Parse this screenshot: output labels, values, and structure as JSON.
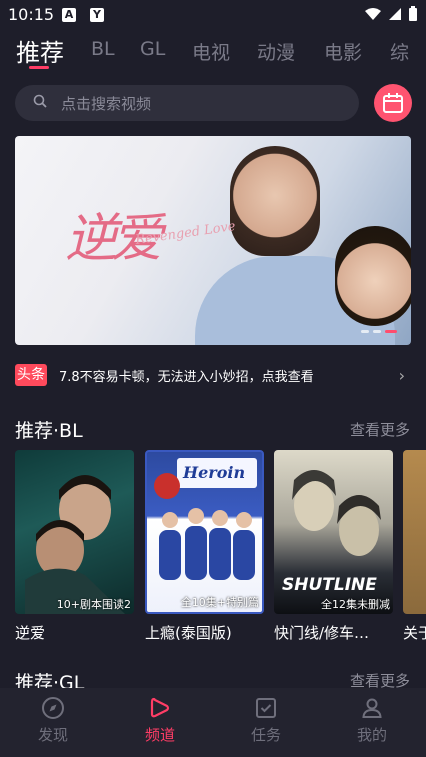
{
  "status": {
    "time": "10:15"
  },
  "tabs": [
    {
      "label": "推荐",
      "active": true
    },
    {
      "label": "BL"
    },
    {
      "label": "GL"
    },
    {
      "label": "电视"
    },
    {
      "label": "动漫"
    },
    {
      "label": "电影"
    },
    {
      "label": "综"
    }
  ],
  "search": {
    "placeholder": "点击搜索视频"
  },
  "banner": {
    "title": "逆爱",
    "subtitle": "Revenged Love",
    "slide_index": 3,
    "slide_count": 3
  },
  "news": {
    "badge": "头条",
    "text": "7.8不容易卡顿，无法进入小妙招，点我查看"
  },
  "section_bl": {
    "title": "推荐·BL",
    "more": "查看更多",
    "items": [
      {
        "name": "逆爱",
        "caption": "10+剧本围读2"
      },
      {
        "name": "上瘾(泰国版)",
        "caption": "全10集+特别篇"
      },
      {
        "name": "快门线/修车…",
        "caption": "全12集未删减"
      },
      {
        "name": "关于",
        "caption": ""
      }
    ]
  },
  "section_gl": {
    "title": "推荐·GL",
    "more": "查看更多"
  },
  "bottom_nav": [
    {
      "label": "发现"
    },
    {
      "label": "频道",
      "active": true
    },
    {
      "label": "任务"
    },
    {
      "label": "我的"
    }
  ],
  "colors": {
    "accent": "#ff3d66",
    "background": "#1e1e2a"
  }
}
